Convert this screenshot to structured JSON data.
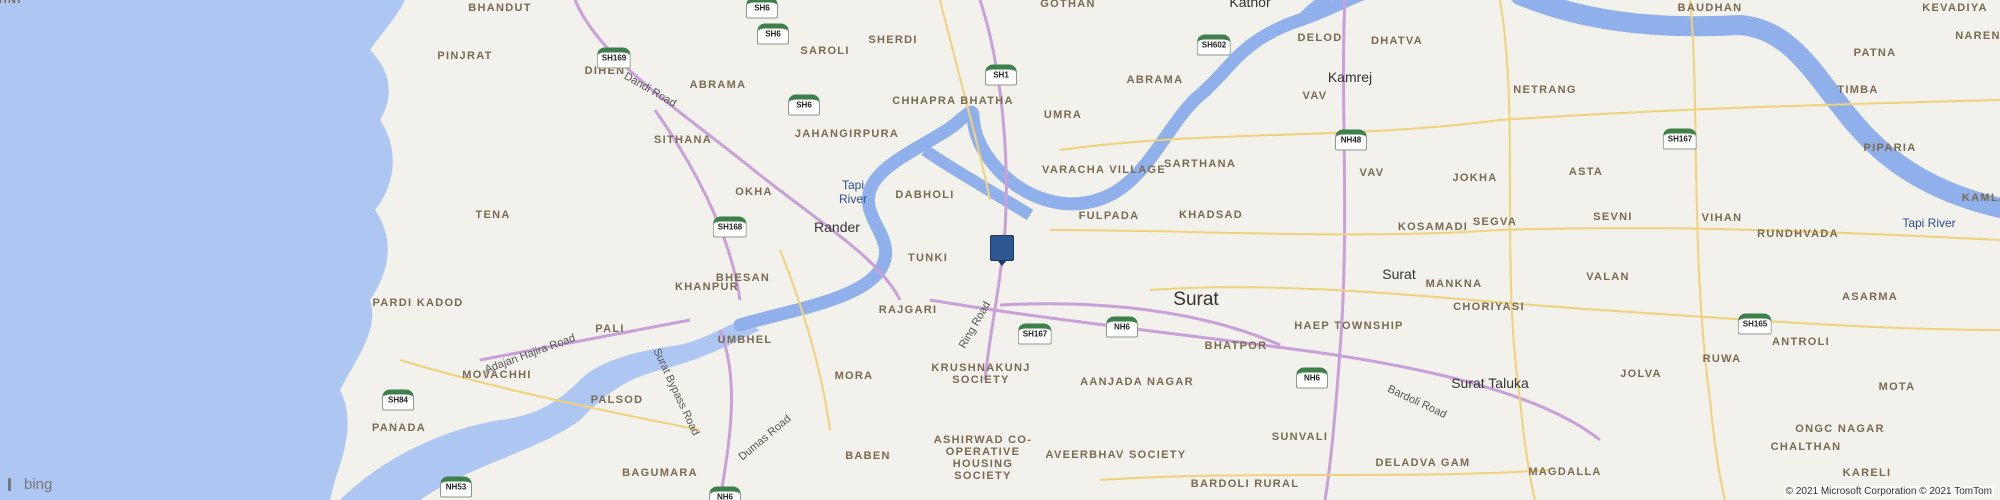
{
  "map": {
    "provider": "bing",
    "copyright": "© 2021 Microsoft Corporation © 2021 TomTom",
    "colors": {
      "land": "#f2f1ec",
      "water": "#aec6f2",
      "river": "#8fb0ea",
      "major_road": "#c9a0d8",
      "road": "#f1d27a",
      "pin": "#2e5692"
    }
  },
  "places": [
    {
      "name": "BHANDUT",
      "x": 1,
      "style": "loc"
    },
    {
      "name": "GOTHAN",
      "style": "loc"
    },
    {
      "name": "Kathor",
      "style": "city"
    },
    {
      "name": "BAUDHAN",
      "style": "loc"
    },
    {
      "name": "KEVADIYA",
      "style": "loc"
    },
    {
      "name": "PINJRAT",
      "style": "loc"
    },
    {
      "name": "SHERDI",
      "style": "loc"
    },
    {
      "name": "DELOD",
      "style": "loc"
    },
    {
      "name": "DHATVA",
      "style": "loc"
    },
    {
      "name": "NAREN",
      "style": "loc"
    },
    {
      "name": "DIHEN",
      "style": "loc"
    },
    {
      "name": "SAROLI",
      "style": "loc"
    },
    {
      "name": "Kamrej",
      "style": "city"
    },
    {
      "name": "PATNA",
      "style": "loc"
    },
    {
      "name": "ABRAMA",
      "style": "loc"
    },
    {
      "name": "ABRAMA",
      "style": "loc"
    },
    {
      "name": "CHHAPRA BHATHA",
      "style": "loc"
    },
    {
      "name": "NETRANG",
      "style": "loc"
    },
    {
      "name": "VAV",
      "style": "loc"
    },
    {
      "name": "TIMBA",
      "style": "loc"
    },
    {
      "name": "JAHANGIRPURA",
      "style": "loc"
    },
    {
      "name": "UMRA",
      "style": "loc"
    },
    {
      "name": "SITHANA",
      "style": "loc"
    },
    {
      "name": "VARACHA VILLAGE",
      "style": "loc"
    },
    {
      "name": "SARTHANA",
      "style": "loc"
    },
    {
      "name": "PIPARIA",
      "style": "loc"
    },
    {
      "name": "VAV",
      "style": "loc"
    },
    {
      "name": "JOKHA",
      "style": "loc"
    },
    {
      "name": "ASTA",
      "style": "loc"
    },
    {
      "name": "KAMLA",
      "style": "loc"
    },
    {
      "name": "OKHA",
      "style": "loc"
    },
    {
      "name": "DABHOLI",
      "style": "loc"
    },
    {
      "name": "KHADSAD",
      "style": "loc"
    },
    {
      "name": "FULPADA",
      "style": "loc"
    },
    {
      "name": "TENA",
      "style": "loc"
    },
    {
      "name": "Rander",
      "style": "city"
    },
    {
      "name": "SEGVA",
      "style": "loc"
    },
    {
      "name": "SEVNI",
      "style": "loc"
    },
    {
      "name": "VIHAN",
      "style": "loc"
    },
    {
      "name": "KOSAMADI",
      "style": "loc"
    },
    {
      "name": "RUNDHVADA",
      "style": "loc"
    },
    {
      "name": "BHESAN",
      "style": "loc"
    },
    {
      "name": "TUNKI",
      "style": "loc"
    },
    {
      "name": "Surat",
      "style": "city"
    },
    {
      "name": "MANKNA",
      "style": "loc"
    },
    {
      "name": "VALAN",
      "style": "loc"
    },
    {
      "name": "KHANPUR",
      "style": "loc"
    },
    {
      "name": "ASARMA",
      "style": "loc"
    },
    {
      "name": "PARDI KADOD",
      "style": "loc"
    },
    {
      "name": "RAJGARI",
      "style": "loc"
    },
    {
      "name": "Surat",
      "style": "city-big"
    },
    {
      "name": "CHORIYASI",
      "style": "loc"
    },
    {
      "name": "PALI",
      "style": "loc"
    },
    {
      "name": "HAEP TOWNSHIP",
      "style": "loc"
    },
    {
      "name": "UMBHEL",
      "style": "loc"
    },
    {
      "name": "BHATPOR",
      "style": "loc"
    },
    {
      "name": "ANTROLI",
      "style": "loc"
    },
    {
      "name": "RUWA",
      "style": "loc"
    },
    {
      "name": "MOVACHHI",
      "style": "loc"
    },
    {
      "name": "MORA",
      "style": "loc"
    },
    {
      "name": "KRUSHNAKUNJ SOCIETY",
      "style": "loc"
    },
    {
      "name": "AANJADA NAGAR",
      "style": "loc"
    },
    {
      "name": "Surat Taluka",
      "style": "city"
    },
    {
      "name": "JOLVA",
      "style": "loc"
    },
    {
      "name": "MOTA",
      "style": "loc"
    },
    {
      "name": "PALSOD",
      "style": "loc"
    },
    {
      "name": "ONGC NAGAR",
      "style": "loc"
    },
    {
      "name": "PANADA",
      "style": "loc"
    },
    {
      "name": "SUNVALI",
      "style": "loc"
    },
    {
      "name": "CHALTHAN",
      "style": "loc"
    },
    {
      "name": "BABEN",
      "style": "loc"
    },
    {
      "name": "ASHIRWAD CO-OPERATIVE HOUSING SOCIETY",
      "style": "loc"
    },
    {
      "name": "AVEERBHAV SOCIETY",
      "style": "loc"
    },
    {
      "name": "DELADVA GAM",
      "style": "loc"
    },
    {
      "name": "BAGUMARA",
      "style": "loc"
    },
    {
      "name": "MAGDALLA",
      "style": "loc"
    },
    {
      "name": "KARELI",
      "style": "loc"
    },
    {
      "name": "BARDOLI RURAL",
      "style": "loc"
    },
    {
      "name": "MOHNI",
      "style": "loc"
    }
  ],
  "water_labels": [
    {
      "name": "Tapi River"
    },
    {
      "name": "Tapi River"
    }
  ],
  "road_labels": [
    {
      "name": "Dandi Road"
    },
    {
      "name": "Adajan Hajira Road"
    },
    {
      "name": "Surat Bypass Road"
    },
    {
      "name": "Ring Road"
    },
    {
      "name": "Dumas Road"
    },
    {
      "name": "Bardoli Road"
    }
  ],
  "shields": [
    "SH6",
    "SH6",
    "SH169",
    "SH6",
    "SH1",
    "SH602",
    "NH48",
    "SH167",
    "SH168",
    "SH167",
    "NH6",
    "NH6",
    "SH165",
    "SH84",
    "NH53",
    "NH6"
  ]
}
